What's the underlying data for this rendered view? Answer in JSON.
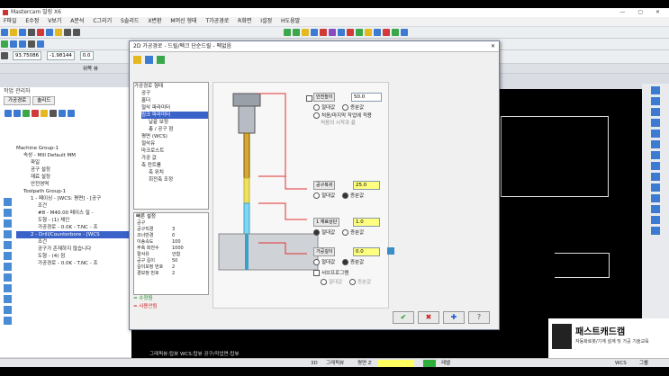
{
  "app": {
    "title": "Mastercam 밀링 X6",
    "window_controls": "— ▢ ✕"
  },
  "menu": [
    "F파일",
    "E수정",
    "V보기",
    "A분석",
    "C그리기",
    "S솔리드",
    "X변환",
    "M머신 형태",
    "T가공경로",
    "R화면",
    "I설정",
    "H도움말"
  ],
  "toolbar": {
    "coord_x": "93.75086",
    "coord_y": "-1.98144",
    "coord_z": "0.0",
    "view_label": "위쪽 뷰"
  },
  "left_panel": {
    "title": "작업 관리자",
    "tabs": [
      "가공경로",
      "솔리드"
    ],
    "tree": [
      {
        "label": "Machine Group-1",
        "selected": false
      },
      {
        "label": "속성 - Mill Default MM",
        "selected": false
      },
      {
        "label": "파일",
        "selected": false
      },
      {
        "label": "공구 설정",
        "selected": false
      },
      {
        "label": "재료 설정",
        "selected": false
      },
      {
        "label": "안전영역",
        "selected": false
      },
      {
        "label": "Toolpath Group-1",
        "selected": false
      },
      {
        "label": "1 - 페이싱 - [WCS: 평면] - [공구",
        "selected": false
      },
      {
        "label": "조건",
        "selected": false
      },
      {
        "label": "#8 - M40.00 페이스 밀 -",
        "selected": false
      },
      {
        "label": "도형 - (1) 체인",
        "selected": false
      },
      {
        "label": "가공경로 - 0.0K - T.NC - 프",
        "selected": false
      },
      {
        "label": "2 - Drill/Counterbore - [WCS",
        "selected": true
      },
      {
        "label": "조건",
        "selected": false
      },
      {
        "label": "공구가 존재하지 않습니다",
        "selected": false
      },
      {
        "label": "도형 - (4) 점",
        "selected": false
      },
      {
        "label": "가공경로 - 0.0K - T.NC - 프",
        "selected": false
      }
    ]
  },
  "dialog": {
    "title": "2D 가공경로 - 드릴/펙크 단순드릴 - 펙없음",
    "close": "✕",
    "tree": [
      {
        "label": "가공경로 형태",
        "selected": false
      },
      {
        "label": "공구",
        "selected": false
      },
      {
        "label": "홀더",
        "selected": false
      },
      {
        "label": "절삭 파라미터",
        "selected": false
      },
      {
        "label": "링크 파라미터",
        "selected": true
      },
      {
        "label": "날끝 보정",
        "selected": false
      },
      {
        "label": "총 / 공구 점",
        "selected": false
      },
      {
        "label": "평면 (WCS)",
        "selected": false
      },
      {
        "label": "절삭유",
        "selected": false
      },
      {
        "label": "마크로스트",
        "selected": false
      },
      {
        "label": "가공 값",
        "selected": false
      },
      {
        "label": "축 컨트롤",
        "selected": false
      },
      {
        "label": "축 위치",
        "selected": false
      },
      {
        "label": "회전축 조정",
        "selected": false
      }
    ],
    "quick": {
      "header": "빠른 설정",
      "rows": [
        {
          "k": "공구",
          "v": ""
        },
        {
          "k": "공구직경",
          "v": "3"
        },
        {
          "k": "코너반경",
          "v": "0"
        },
        {
          "k": "이송속도",
          "v": "100"
        },
        {
          "k": "주축 회전수",
          "v": "1000"
        },
        {
          "k": "절삭유",
          "v": "안함"
        },
        {
          "k": "공구 길이",
          "v": "50"
        },
        {
          "k": "길이보정 번호",
          "v": "2"
        },
        {
          "k": "경보정 번호",
          "v": "2"
        }
      ]
    },
    "legend": {
      "ok": "= 수정됨",
      "bad": "= 사용안됨"
    },
    "clearance": {
      "label": "안전높이",
      "value": "50.0",
      "opt_abs": "절대값",
      "opt_inc": "증분값",
      "note1": "처음/마지막 작업에 적용",
      "note2": "처음의 시작과 끝"
    },
    "retract": {
      "label": "공구복귀",
      "value": "25.0",
      "opt_abs": "절대값",
      "opt_inc": "증분값"
    },
    "top": {
      "label": "1 재료상단",
      "value": "1.0",
      "opt_abs": "절대값",
      "opt_inc": "증분값"
    },
    "depth": {
      "label": "가공깊이",
      "value": "0.0",
      "opt_abs": "절대값",
      "opt_inc": "증분값"
    },
    "subprog": {
      "label": "서브프로그램",
      "opt_abs": "절대값",
      "opt_inc": "증분값"
    },
    "buttons": [
      "✔",
      "✖",
      "✚",
      "?"
    ]
  },
  "viewport": {
    "bottom_text": "그래픽뷰:탑뷰    WCS:탑뷰    공구/작업면:탑뷰"
  },
  "statusbar": {
    "mode": "3D",
    "graphic": "그래픽뷰",
    "plane": "평면 Z",
    "level": "레벨",
    "wcs": "WCS",
    "group": "그룹"
  },
  "watermark": {
    "title": "패스트캐드캠",
    "subtitle": "자동화로봇/기계 설계 및 가공 기술교육"
  },
  "colors": {
    "accent": "#3a62c8",
    "highlight": "#ffff80",
    "red_line": "#e03030",
    "yellow_tool": "#f0e060"
  }
}
